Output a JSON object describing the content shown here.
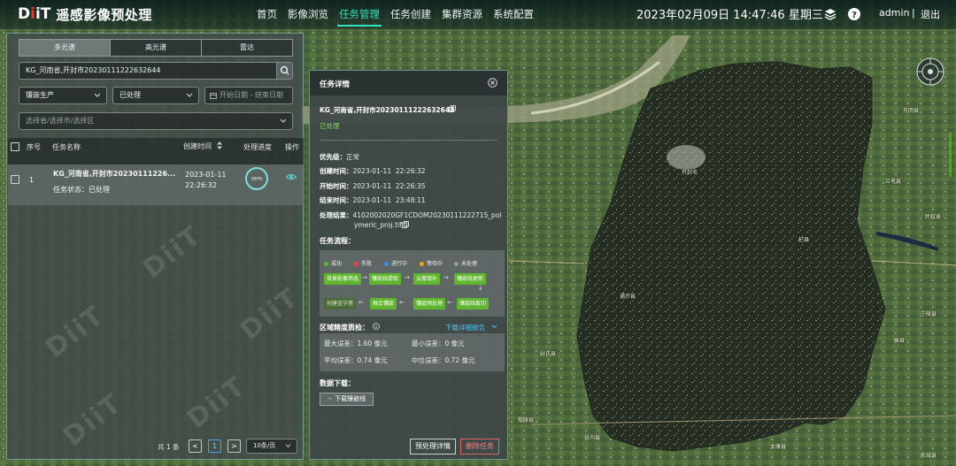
{
  "app": {
    "logo_text": "DiiT",
    "title": "遥感影像预处理"
  },
  "nav": [
    {
      "label": "首页",
      "active": false
    },
    {
      "label": "影像浏览",
      "active": false
    },
    {
      "label": "任务管理",
      "active": true
    },
    {
      "label": "任务创建",
      "active": false
    },
    {
      "label": "集群资源",
      "active": false
    },
    {
      "label": "系统配置",
      "active": false
    }
  ],
  "header": {
    "datetime": "2023年02月09日 14:47:46 星期三",
    "user": "admin",
    "separator": "|",
    "logout": "退出",
    "layers_icon": "layers-icon",
    "help_icon": "help-icon"
  },
  "left_panel": {
    "tabs": [
      {
        "label": "多光谱",
        "active": true
      },
      {
        "label": "高光谱",
        "active": false
      },
      {
        "label": "雷达",
        "active": false
      }
    ],
    "search_value": "KG_河南省,开封市20230111222632644",
    "filters": {
      "production": "镶嵌生产",
      "status": "已处理",
      "date_placeholder": "开始日期 - 结束日期",
      "region_placeholder": "选择省/选择市/选择区"
    },
    "table": {
      "headers": [
        "序号",
        "任务名称",
        "创建时间",
        "处理进度",
        "操作"
      ],
      "rows": [
        {
          "index": "1",
          "name": "KG_河南省,开封市20230111226...",
          "status_label": "任务状态：",
          "status_value": "已处理",
          "created_date": "2023-01-11",
          "created_time": "22:26:32",
          "progress": 100,
          "progress_label": "100%"
        }
      ]
    },
    "pagination": {
      "total": "共 1 条",
      "current_page": "1",
      "page_size": "10条/页",
      "prev": "<",
      "next": ">"
    },
    "watermark": "DiiT"
  },
  "detail": {
    "title": "任务详情",
    "task_name": "KG_河南省,开封市20230111222632644",
    "state": "已处理",
    "fields": [
      {
        "label": "优先级：",
        "value": "正常"
      },
      {
        "label": "创建时间：",
        "value": "2023-01-11  22:26:32"
      },
      {
        "label": "开始时间：",
        "value": "2023-01-11  22:26:35"
      },
      {
        "label": "结束时间：",
        "value": "2023-01-11  23:48:11"
      }
    ],
    "result_label": "处理结果：",
    "result_line1": "4102002020GF1CDOM20230111222715_pol",
    "result_line2": "ymeric_proj.tif",
    "flow_title": "任务流程：",
    "legend": [
      {
        "label": "成功",
        "color": "#5fb52e"
      },
      {
        "label": "失败",
        "color": "#e04848"
      },
      {
        "label": "进行中",
        "color": "#3b8fe8"
      },
      {
        "label": "等待中",
        "color": "#f0a020"
      },
      {
        "label": "未处理",
        "color": "#9a9a9a"
      }
    ],
    "steps_row1": [
      "背景影像筛选",
      "镶嵌线提取",
      "云層填补",
      "镶嵌线更新"
    ],
    "steps_row2": [
      "创建金字塔",
      "融合镶嵌",
      "镶嵌预处理",
      "镶嵌线裁切"
    ],
    "qc_title": "区域精度质检：",
    "qc_download": "下载详细报告",
    "qc": [
      {
        "label": "最大误差：",
        "value": "1.60 像元"
      },
      {
        "label": "最小误差：",
        "value": "0 像元"
      },
      {
        "label": "平均误差：",
        "value": "0.74 像元"
      },
      {
        "label": "中位误差：",
        "value": "0.72 像元"
      }
    ],
    "download_title": "数据下载：",
    "download_button": "下载镶嵌线",
    "btn_detail": "预处理详情",
    "btn_delete": "删除任务"
  },
  "map_labels": [
    {
      "text": "开封市"
    },
    {
      "text": "兰考县"
    },
    {
      "text": "杞县"
    },
    {
      "text": "通许县"
    },
    {
      "text": "尉氏县"
    },
    {
      "text": "太康县"
    },
    {
      "text": "柘城县"
    },
    {
      "text": "睢县"
    },
    {
      "text": "宁陵县"
    },
    {
      "text": "东明县"
    },
    {
      "text": "民权县"
    },
    {
      "text": "扶沟县"
    },
    {
      "text": "鄢陵县"
    }
  ]
}
